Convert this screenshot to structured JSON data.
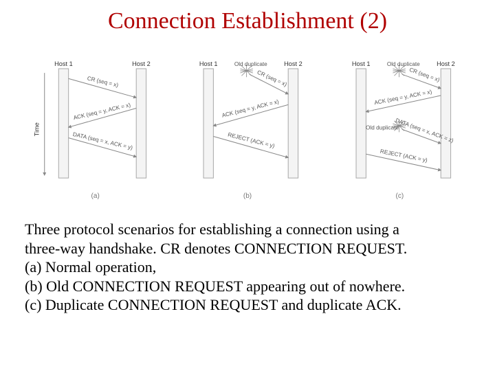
{
  "title": "Connection Establishment (2)",
  "hosts": {
    "h1": "Host 1",
    "h2": "Host 2"
  },
  "time_label": "Time",
  "starburst_label": "Old duplicate",
  "panels": {
    "a": {
      "sub": "(a)",
      "msgs": {
        "m1": "CR (seq = x)",
        "m2": "ACK (seq = y, ACK = x)",
        "m3": "DATA (seq = x, ACK = y)"
      }
    },
    "b": {
      "sub": "(b)",
      "msgs": {
        "m1": "CR (seq = x)",
        "m2": "ACK (seq = y, ACK = x)",
        "m3": "REJECT (ACK = y)"
      }
    },
    "c": {
      "sub": "(c)",
      "msgs": {
        "m1": "CR (seq = x)",
        "m2": "ACK (seq = y, ACK = x)",
        "m3": "DATA (seq = x, ACK = z)",
        "m4": "REJECT (ACK = y)"
      },
      "note2": "Old duplicate"
    }
  },
  "caption": {
    "l1": "Three protocol scenarios for establishing a connection using a",
    "l2": "three-way handshake.  CR denotes CONNECTION REQUEST.",
    "l3": "(a) Normal operation,",
    "l4": "(b) Old CONNECTION REQUEST appearing out of nowhere.",
    "l5": "(c) Duplicate CONNECTION REQUEST and duplicate ACK."
  }
}
